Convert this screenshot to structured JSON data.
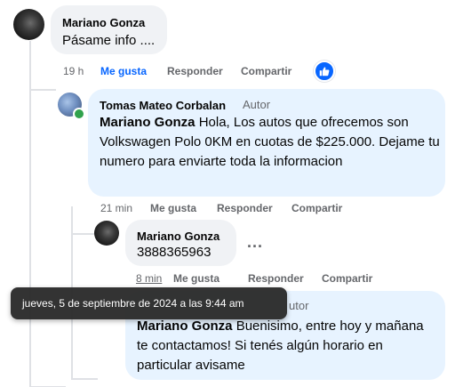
{
  "comments": [
    {
      "author": "Mariano Gonza",
      "text": "Pásame info ....",
      "time": "19 h",
      "actions": {
        "like": "Me gusta",
        "reply": "Responder",
        "share": "Compartir"
      },
      "reaction_icon": "thumbs-up-icon"
    },
    {
      "author": "Tomas Mateo Corbalan",
      "badge": "Autor",
      "mention": "Mariano Gonza",
      "text": "Hola, Los autos que ofrecemos son Volkswagen Polo 0KM en cuotas de $225.000. Dejame tu numero para enviarte toda la informacion",
      "time": "21 min",
      "actions": {
        "like": "Me gusta",
        "reply": "Responder",
        "share": "Compartir"
      }
    },
    {
      "author": "Mariano Gonza",
      "text": "3888365963",
      "time": "8 min",
      "actions": {
        "like": "Me gusta",
        "reply": "Responder",
        "share": "Compartir"
      },
      "more_label": "..."
    },
    {
      "badge_partial": "utor",
      "mention": "Mariano Gonza",
      "text": "Buenisimo, entre hoy y mañana te contactamos! Si tenés algún horario en particular avisame"
    }
  ],
  "tooltip": {
    "text": "jueves, 5 de septiembre de 2024 a las 9:44 am"
  },
  "colors": {
    "link_blue": "#0866ff",
    "bubble_gray": "#f0f2f5",
    "bubble_blue": "#e7f3ff",
    "meta_gray": "#65676b"
  }
}
